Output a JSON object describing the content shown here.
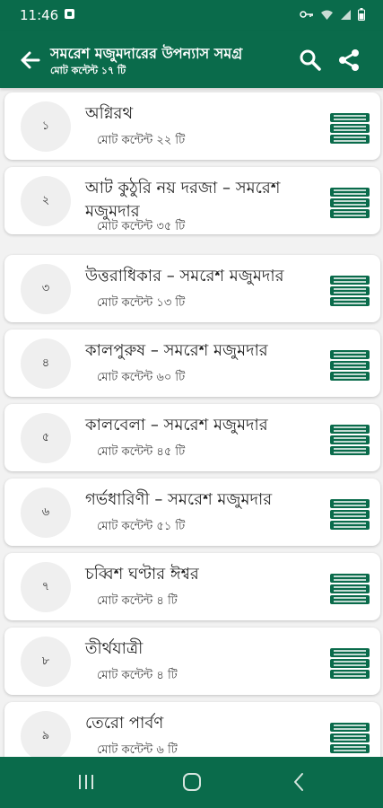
{
  "status_bar": {
    "time": "11:46"
  },
  "app_bar": {
    "title": "সমরেশ মজুমদারের উপন্যাস সমগ্র",
    "subtitle": "মোট কন্টেন্ট ১৭ টি"
  },
  "colors": {
    "primary": "#0a6b4b",
    "background": "#f2f2f2",
    "card": "#ffffff"
  },
  "icons": {
    "back": "arrow-left-icon",
    "search": "search-icon",
    "share": "share-icon",
    "item": "books-stack-icon",
    "nav": [
      "recents-icon",
      "home-icon",
      "back-icon"
    ]
  },
  "items": [
    {
      "number": "১",
      "title": "অগ্নিরথ",
      "count": "মোট কন্টেন্ট ২২ টি"
    },
    {
      "number": "২",
      "title": "আট কুঠুরি নয় দরজা – সমরেশ মজুমদার",
      "count": "মোট কন্টেন্ট ৩৫ টি"
    },
    {
      "number": "৩",
      "title": "উত্তরাধিকার – সমরেশ মজুমদার",
      "count": "মোট কন্টেন্ট ১৩ টি"
    },
    {
      "number": "৪",
      "title": "কালপুরুষ – সমরেশ মজুমদার",
      "count": "মোট কন্টেন্ট ৬০ টি"
    },
    {
      "number": "৫",
      "title": "কালবেলা – সমরেশ মজুমদার",
      "count": "মোট কন্টেন্ট ৪৫ টি"
    },
    {
      "number": "৬",
      "title": "গর্ভধারিণী – সমরেশ মজুমদার",
      "count": "মোট কন্টেন্ট ৫১ টি"
    },
    {
      "number": "৭",
      "title": "চব্বিশ ঘণ্টার ঈশ্বর",
      "count": "মোট কন্টেন্ট ৪ টি"
    },
    {
      "number": "৮",
      "title": "তীর্থযাত্রী",
      "count": "মোট কন্টেন্ট ৪ টি"
    },
    {
      "number": "৯",
      "title": "তেরো পার্বণ",
      "count": "মোট কন্টেন্ট ৬ টি"
    }
  ]
}
